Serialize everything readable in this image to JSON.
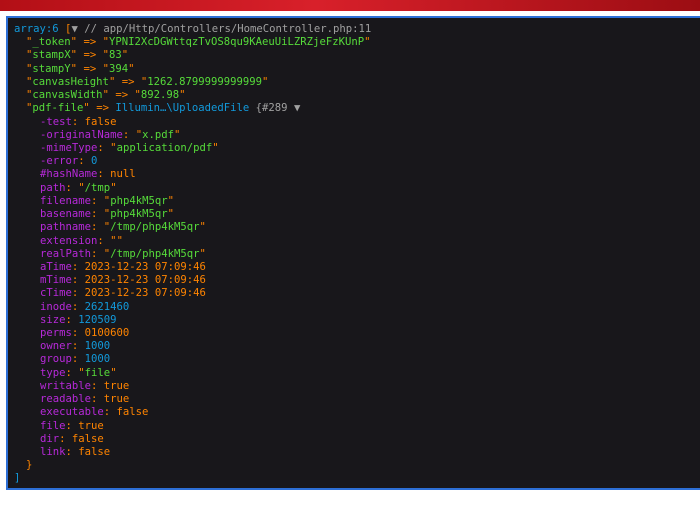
{
  "header": {
    "array_label": "array:6",
    "open_bracket": "[",
    "toggle_glyph": "▼",
    "file_comment": "// app/Http/Controllers/HomeController.php:11"
  },
  "entries": [
    {
      "key": "_token",
      "value": "YPNI2XcDGWttqzTvOS8qu9KAeuUiLZRZjeFzKUnP"
    },
    {
      "key": "stampX",
      "value": "83"
    },
    {
      "key": "stampY",
      "value": "394"
    },
    {
      "key": "canvasHeight",
      "value": "1262.8799999999999"
    },
    {
      "key": "canvasWidth",
      "value": "892.98"
    }
  ],
  "pdf_file": {
    "key": "pdf-file",
    "class_name": "Illumin…\\UploadedFile",
    "ref": "{#289",
    "toggle_glyph": "▼",
    "private_props": [
      {
        "name": "-test",
        "value": "false",
        "kind": "bool"
      },
      {
        "name": "-originalName",
        "value": "x.pdf",
        "kind": "str"
      },
      {
        "name": "-mimeType",
        "value": "application/pdf",
        "kind": "str"
      },
      {
        "name": "-error",
        "value": "0",
        "kind": "num"
      },
      {
        "name": "#hashName",
        "value": "null",
        "kind": "bool"
      }
    ],
    "props": [
      {
        "name": "path",
        "value": "/tmp",
        "kind": "str"
      },
      {
        "name": "filename",
        "value": "php4kM5qr",
        "kind": "str"
      },
      {
        "name": "basename",
        "value": "php4kM5qr",
        "kind": "str"
      },
      {
        "name": "pathname",
        "value": "/tmp/php4kM5qr",
        "kind": "str"
      },
      {
        "name": "extension",
        "value": "",
        "kind": "str"
      },
      {
        "name": "realPath",
        "value": "/tmp/php4kM5qr",
        "kind": "str"
      },
      {
        "name": "aTime",
        "value": "2023-12-23 07:09:46",
        "kind": "date"
      },
      {
        "name": "mTime",
        "value": "2023-12-23 07:09:46",
        "kind": "date"
      },
      {
        "name": "cTime",
        "value": "2023-12-23 07:09:46",
        "kind": "date"
      },
      {
        "name": "inode",
        "value": "2621460",
        "kind": "num"
      },
      {
        "name": "size",
        "value": "120509",
        "kind": "num"
      },
      {
        "name": "perms",
        "value": "0100600",
        "kind": "date"
      },
      {
        "name": "owner",
        "value": "1000",
        "kind": "num"
      },
      {
        "name": "group",
        "value": "1000",
        "kind": "num"
      },
      {
        "name": "type",
        "value": "file",
        "kind": "str"
      },
      {
        "name": "writable",
        "value": "true",
        "kind": "bool"
      },
      {
        "name": "readable",
        "value": "true",
        "kind": "bool"
      },
      {
        "name": "executable",
        "value": "false",
        "kind": "bool"
      },
      {
        "name": "file",
        "value": "true",
        "kind": "bool"
      },
      {
        "name": "dir",
        "value": "false",
        "kind": "bool"
      },
      {
        "name": "link",
        "value": "false",
        "kind": "bool"
      }
    ],
    "close_brace": "}"
  },
  "footer": {
    "close_bracket": "]"
  },
  "colors": {
    "background": "#18171b",
    "border": "#2d6fd6",
    "banner": "#c8141d",
    "key_string": "#56db3a",
    "operator": "#ff8400",
    "property": "#b729d9",
    "number": "#1299da",
    "meta": "#a0a0a0"
  }
}
